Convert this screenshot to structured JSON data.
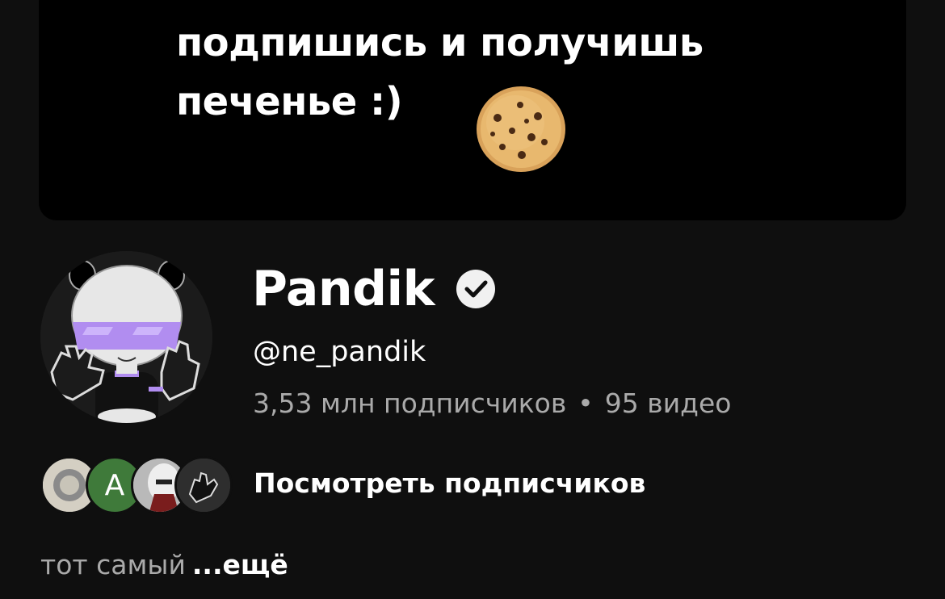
{
  "banner": {
    "line1": "подпишись и получишь",
    "line2": "печенье :)",
    "image": "cookie"
  },
  "channel": {
    "avatar": "panda-avatar",
    "name": "Pandik",
    "verified_icon": "verified-check-icon",
    "handle": "@ne_pandik",
    "subscribers": "3,53 млн подписчиков",
    "separator": "•",
    "videos": "95 видео"
  },
  "subscribers_preview": {
    "avatars": [
      "subscriber-avatar-1",
      "A",
      "subscriber-avatar-3",
      "subscriber-avatar-4"
    ],
    "link_label": "Посмотреть подписчиков"
  },
  "description": {
    "text": "тот самый",
    "more_label": "...ещё"
  },
  "colors": {
    "background": "#0f0f0f",
    "banner_background": "#000000",
    "text_primary": "#ffffff",
    "text_secondary": "#aaaaaa",
    "avatar_accent": "#b18df0",
    "subscriber_a_bg": "#3f7a3a"
  }
}
